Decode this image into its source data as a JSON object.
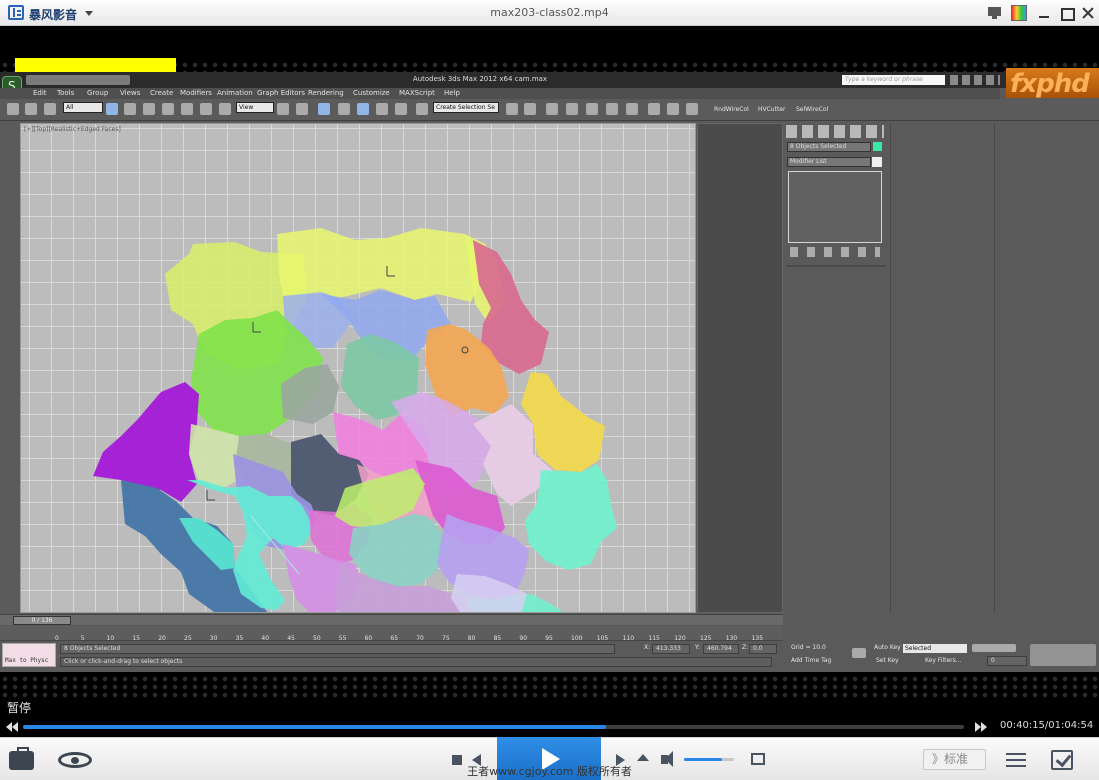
{
  "player": {
    "brand": "暴风影音",
    "window_title": "max203-class02.mp4",
    "status_text": "暂停",
    "progress_fraction": 0.62,
    "volume_fraction": 0.75,
    "time_current": "00:40:15",
    "time_total": "01:04:54",
    "time_display": "00:40:15/01:04:54",
    "quality_label": "》标准",
    "copyright": "王者www.cgjoy.com 版权所有者"
  },
  "max": {
    "app_title": "Autodesk 3ds Max 2012 x64      cam.max",
    "search_placeholder": "Type a keyword or phrase",
    "watermark": "fxphd",
    "menu": [
      "Edit",
      "Tools",
      "Group",
      "Views",
      "Create",
      "Modifiers",
      "Animation",
      "Graph Editors",
      "Rendering",
      "Customize",
      "MAXScript",
      "Help"
    ],
    "toolbar": {
      "filter": "All",
      "ref_coord": "View",
      "selection_set": "Create Selection Se",
      "plugins": [
        "RndWireCol",
        "HVCutter",
        "SelWireCol"
      ]
    },
    "viewport_label": "[+][Top][Realistic+Edged Faces]",
    "command_panel": {
      "selection_info": "8 Objects Selected",
      "modifier_list": "Modifier List"
    },
    "timeline": {
      "frame_display": "0 / 136",
      "ticks": [
        "0",
        "5",
        "10",
        "15",
        "20",
        "25",
        "30",
        "35",
        "40",
        "45",
        "50",
        "55",
        "60",
        "65",
        "70",
        "75",
        "80",
        "85",
        "90",
        "95",
        "100",
        "105",
        "110",
        "115",
        "120",
        "125",
        "130",
        "135"
      ]
    },
    "status": {
      "objects_selected": "8 Objects Selected",
      "prompt": "Click or click-and-drag to select objects",
      "listener": "Max to Physc",
      "x_label": "X:",
      "x_value": "413.333",
      "y_label": "Y:",
      "y_value": "460.794",
      "z_label": "Z:",
      "z_value": "0.0",
      "grid": "Grid = 10.0",
      "add_time_tag": "Add Time Tag",
      "auto_key": "Auto Key",
      "selected": "Selected",
      "set_key": "Set Key",
      "key_filters": "Key Filters...",
      "frame": "0"
    }
  },
  "colors": {
    "progress": "#2b87e6",
    "play_button": "#1f7ad8",
    "highlight_bar": "#ffff00"
  }
}
